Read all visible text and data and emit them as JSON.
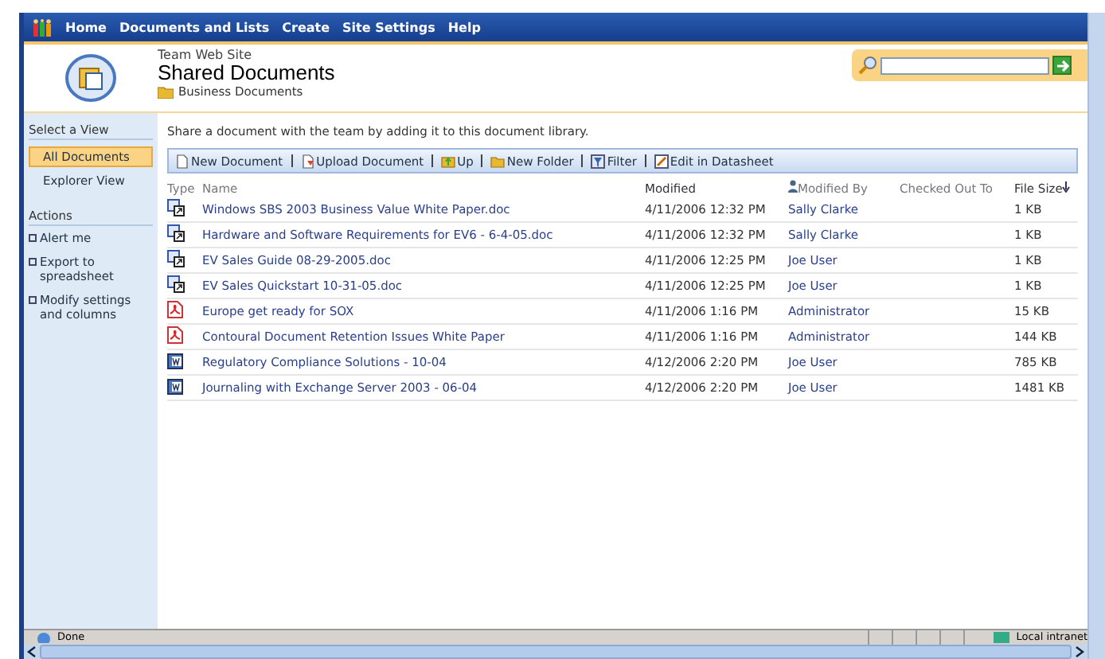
{
  "nav": [
    "Home",
    "Documents and Lists",
    "Create",
    "Site Settings",
    "Help"
  ],
  "header": {
    "site": "Team Web Site",
    "title": "Shared Documents",
    "folder": "Business Documents"
  },
  "sidebar": {
    "view_heading": "Select a View",
    "views": [
      {
        "label": "All Documents",
        "selected": true
      },
      {
        "label": "Explorer View",
        "selected": false
      }
    ],
    "actions_heading": "Actions",
    "actions": [
      "Alert me",
      "Export to spreadsheet",
      "Modify settings and columns"
    ]
  },
  "description": "Share a document with the team by adding it to this document library.",
  "toolbar": [
    "New Document",
    "Upload Document",
    "Up",
    "New Folder",
    "Filter",
    "Edit in Datasheet"
  ],
  "table": {
    "columns": [
      "Type",
      "Name",
      "Modified",
      "Modified By",
      "Checked Out To",
      "File Size"
    ],
    "rows": [
      {
        "kind": "doc",
        "name": "Windows SBS 2003 Business Value White Paper.doc",
        "modified": "4/11/2006 12:32 PM",
        "by": "Sally Clarke",
        "size": "1 KB"
      },
      {
        "kind": "doc",
        "name": "Hardware and Software Requirements for EV6 - 6-4-05.doc",
        "modified": "4/11/2006 12:32 PM",
        "by": "Sally Clarke",
        "size": "1 KB"
      },
      {
        "kind": "doc",
        "name": "EV Sales Guide 08-29-2005.doc",
        "modified": "4/11/2006 12:25 PM",
        "by": "Joe User",
        "size": "1 KB"
      },
      {
        "kind": "doc",
        "name": "EV Sales Quickstart 10-31-05.doc",
        "modified": "4/11/2006 12:25 PM",
        "by": "Joe User",
        "size": "1 KB"
      },
      {
        "kind": "pdf",
        "name": "Europe get ready for SOX",
        "modified": "4/11/2006 1:16 PM",
        "by": "Administrator",
        "size": "15 KB"
      },
      {
        "kind": "pdf",
        "name": "Contoural Document Retention Issues White Paper",
        "modified": "4/11/2006 1:16 PM",
        "by": "Administrator",
        "size": "144 KB"
      },
      {
        "kind": "word",
        "name": "Regulatory Compliance Solutions - 10-04",
        "modified": "4/12/2006 2:20 PM",
        "by": "Joe User",
        "size": "785 KB"
      },
      {
        "kind": "word",
        "name": "Journaling with Exchange Server 2003 - 06-04",
        "modified": "4/12/2006 2:20 PM",
        "by": "Joe User",
        "size": "1481 KB"
      }
    ]
  },
  "status_bar": {
    "left": "Done",
    "right": "Local intranet"
  }
}
